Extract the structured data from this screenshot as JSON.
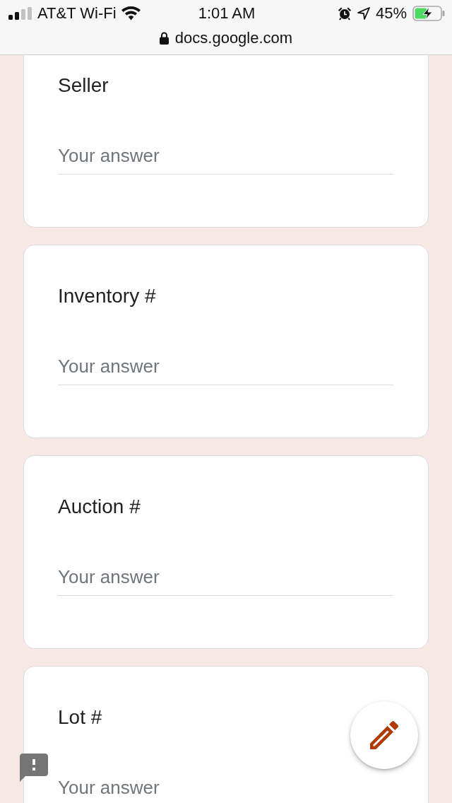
{
  "status_bar": {
    "carrier": "AT&T Wi-Fi",
    "time": "1:01 AM",
    "battery_percent": "45%"
  },
  "address_bar": {
    "url": "docs.google.com"
  },
  "questions": [
    {
      "title": "Seller",
      "placeholder": "Your answer"
    },
    {
      "title": "Inventory #",
      "placeholder": "Your answer"
    },
    {
      "title": "Auction #",
      "placeholder": "Your answer"
    },
    {
      "title": "Lot #",
      "placeholder": "Your answer"
    }
  ]
}
